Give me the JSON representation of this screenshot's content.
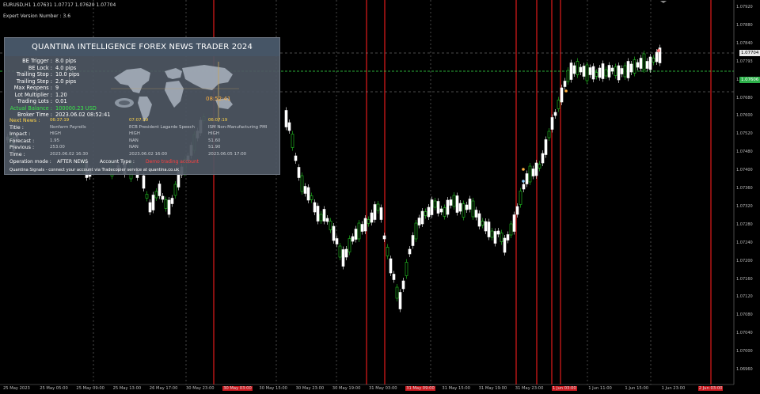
{
  "chart_header": {
    "symbol_line": "EURUSD,H1 1.07631 1.07717 1.07620 1.07704",
    "expert_line": "Expert Version Number : 3.6"
  },
  "panel": {
    "title": "QUANTINA INTELLIGENCE FOREX NEWS TRADER 2024",
    "settings": [
      {
        "label": "BE Trigger :",
        "value": "8.0 pips"
      },
      {
        "label": "BE Lock :",
        "value": "4.0 pips"
      },
      {
        "label": "Trailing Stop :",
        "value": "10.0 pips"
      },
      {
        "label": "Trailing Step :",
        "value": "2.0 pips"
      },
      {
        "label": "Max Reopens :",
        "value": "9"
      },
      {
        "label": "Lot Multiplier :",
        "value": "1.20"
      },
      {
        "label": "Trading Lots :",
        "value": "0.01"
      },
      {
        "label": "Actual Balance :",
        "value": "100000.23 USD"
      },
      {
        "label": "Broker Time :",
        "value": "2023.06.02 08:52:41"
      }
    ],
    "map_time": "08:52:41",
    "news_table": {
      "row_labels": [
        "Next News :",
        "Title :",
        "Impact :",
        "Forecast :",
        "Previous :",
        "Time :"
      ],
      "columns": [
        [
          "06:37:19",
          "Nonfarm Payrolls",
          "HIGH",
          "1.95",
          "253.00",
          "2023.06.02 16:30"
        ],
        [
          "07:07:19",
          "ECB President Lagarde Speech",
          "HIGH",
          "NAN",
          "NAN",
          "2023.06.02 16:00"
        ],
        [
          "06:07:19",
          "ISM Non-Manufacturing PMI",
          "HIGH",
          "51.60",
          "51.90",
          "2023.06.05 17:00"
        ]
      ]
    },
    "mode_label": "Operation mode :",
    "mode_value": "AFTER NEWS",
    "account_label": "Account Type :",
    "account_value": "Demo trading account",
    "footer": "Quantina Signals - connect your account via Tradecopier service at quantina.co.uk"
  },
  "price_axis": {
    "labels": [
      "1.07920",
      "1.07880",
      "1.07840",
      "1.07793",
      "1.07760",
      "1.07680",
      "1.07600",
      "1.07520",
      "1.07480",
      "1.07400",
      "1.07360",
      "1.07320",
      "1.07280",
      "1.07240",
      "1.07200",
      "1.07160",
      "1.07120",
      "1.07080",
      "1.07040",
      "1.07000",
      "1.06960"
    ],
    "current_price": "1.07704",
    "bid_price": "1.07606"
  },
  "time_axis": {
    "labels": [
      {
        "text": "25 May 2023",
        "red": false
      },
      {
        "text": "25 May 05:00",
        "red": false
      },
      {
        "text": "25 May 09:00",
        "red": false
      },
      {
        "text": "25 May 13:00",
        "red": false
      },
      {
        "text": "26 May 17:00",
        "red": false
      },
      {
        "text": "30 May 23:00",
        "red": false
      },
      {
        "text": "30 May 03:00",
        "red": true
      },
      {
        "text": "30 May 15:00",
        "red": false
      },
      {
        "text": "30 May 23:00",
        "red": false
      },
      {
        "text": "30 May 19:00",
        "red": false
      },
      {
        "text": "31 May 03:00",
        "red": false
      },
      {
        "text": "31 May 09:00",
        "red": true
      },
      {
        "text": "31 May 15:00",
        "red": false
      },
      {
        "text": "31 May 19:00",
        "red": false
      },
      {
        "text": "31 May 23:00",
        "red": false
      },
      {
        "text": "1 Jun 03:00",
        "red": true
      },
      {
        "text": "1 Jun 11:00",
        "red": false
      },
      {
        "text": "1 Jun 15:00",
        "red": false
      },
      {
        "text": "1 Jun 23:00",
        "red": false
      },
      {
        "text": "2 Jun 03:00",
        "red": true
      }
    ]
  },
  "colors": {
    "background": "#000000",
    "bull": "#ffffff",
    "bear": "#22cc22",
    "news_line": "#d01818",
    "grid": "#7a7a7a",
    "level_line": "#39e64a"
  }
}
